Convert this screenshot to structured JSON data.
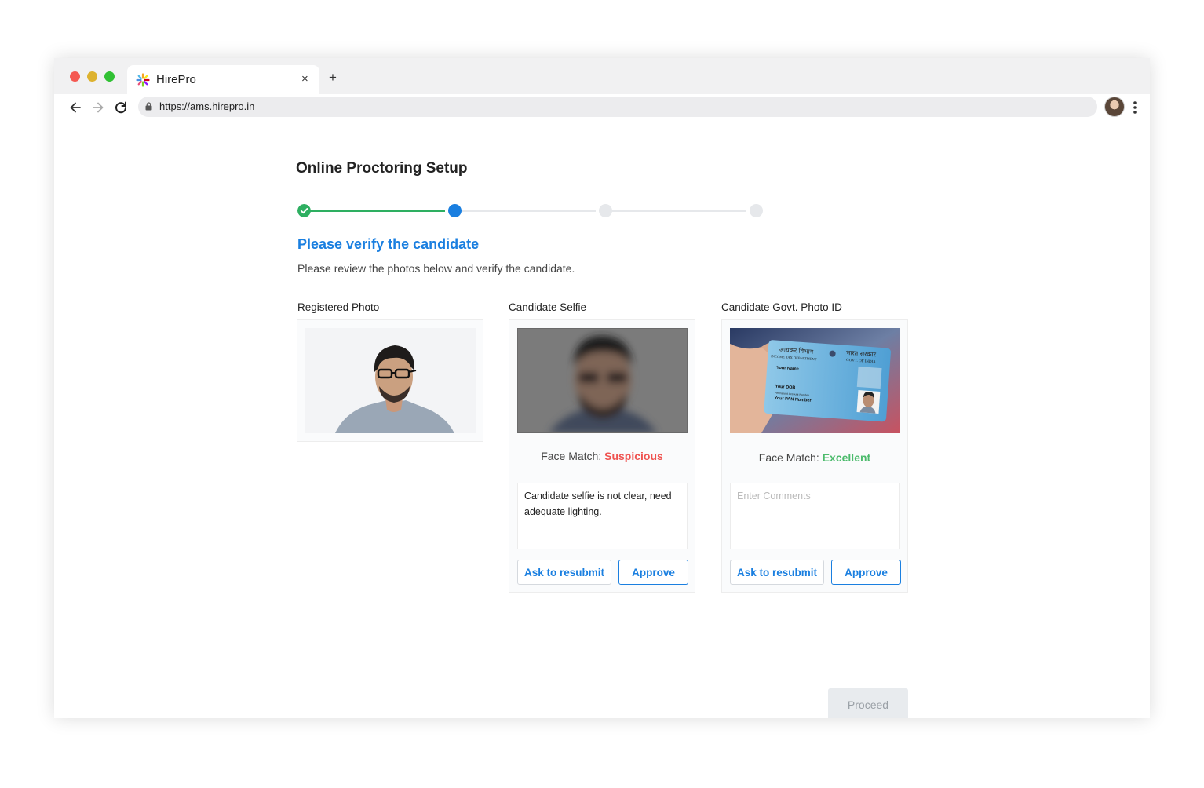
{
  "browser": {
    "tab_title": "HirePro",
    "tab_close": "×",
    "new_tab": "+",
    "url": "https://ams.hirepro.in"
  },
  "page": {
    "title": "Online Proctoring Setup",
    "stepper": {
      "steps": [
        "completed",
        "current",
        "pending",
        "pending"
      ],
      "colors": {
        "completed": "#2eaf61",
        "current": "#1a7fe0",
        "pending": "#e6e8eb"
      }
    },
    "heading": "Please verify the candidate",
    "subheading": "Please review the photos below and verify the candidate."
  },
  "columns": {
    "registered": {
      "label": "Registered Photo"
    },
    "selfie": {
      "label": "Candidate Selfie",
      "face_match_label": "Face Match:",
      "face_match_value": "Suspicious",
      "comment": "Candidate selfie is not clear, need adequate lighting.",
      "comment_placeholder": "Enter Comments",
      "resubmit_label": "Ask to resubmit",
      "approve_label": "Approve"
    },
    "govt_id": {
      "label": "Candidate Govt. Photo ID",
      "face_match_label": "Face Match:",
      "face_match_value": "Excellent",
      "comment": "",
      "comment_placeholder": "Enter Comments",
      "resubmit_label": "Ask to resubmit",
      "approve_label": "Approve",
      "id_card": {
        "dept_hindi": "आयकर विभाग",
        "govt_hindi": "भारत सरकार",
        "dept": "INCOME TAX DEPARTMENT",
        "govt": "GOVT. OF INDIA",
        "name": "Your Name",
        "dob": "Your DOB",
        "pan_caption": "Permanent Account Number",
        "pan": "Your PAN Number"
      }
    }
  },
  "footer": {
    "proceed_label": "Proceed"
  }
}
